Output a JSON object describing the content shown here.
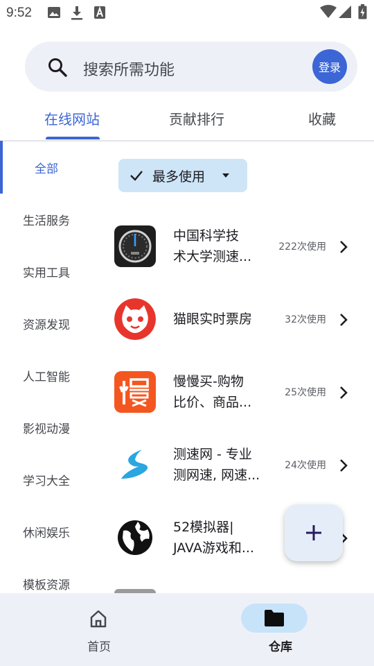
{
  "status": {
    "time": "9:52"
  },
  "search": {
    "placeholder": "搜索所需功能",
    "login_label": "登录"
  },
  "tabs": [
    {
      "label": "在线网站",
      "active": true
    },
    {
      "label": "贡献排行",
      "active": false
    },
    {
      "label": "收藏",
      "active": false
    }
  ],
  "sidebar": {
    "items": [
      {
        "label": "全部",
        "active": true
      },
      {
        "label": "生活服务"
      },
      {
        "label": "实用工具"
      },
      {
        "label": "资源发现"
      },
      {
        "label": "人工智能"
      },
      {
        "label": "影视动漫"
      },
      {
        "label": "学习大全"
      },
      {
        "label": "休闲娱乐"
      },
      {
        "label": "模板资源"
      }
    ]
  },
  "filter": {
    "label": "最多使用"
  },
  "list": [
    {
      "title": "中国科学技\n术大学测速...",
      "uses": "222次使用",
      "icon": "speedometer-icon"
    },
    {
      "title": "猫眼实时票房",
      "uses": "32次使用",
      "icon": "cat-logo-icon"
    },
    {
      "title": "慢慢买-购物\n比价、商品...",
      "uses": "25次使用",
      "icon": "manmanmai-logo-icon"
    },
    {
      "title": "测速网 - 专业\n测网速, 网速...",
      "uses": "24次使用",
      "icon": "speedtest-logo-icon"
    },
    {
      "title": "52模拟器|\nJAVA游戏和...",
      "uses": "",
      "icon": "globe-icon"
    }
  ],
  "bottom_nav": [
    {
      "label": "首页",
      "icon": "home-icon",
      "active": false
    },
    {
      "label": "仓库",
      "icon": "folder-icon",
      "active": true
    }
  ],
  "colors": {
    "accent": "#3c66d6",
    "chip": "#cde5f7",
    "nav_bg": "#edf1f7"
  }
}
